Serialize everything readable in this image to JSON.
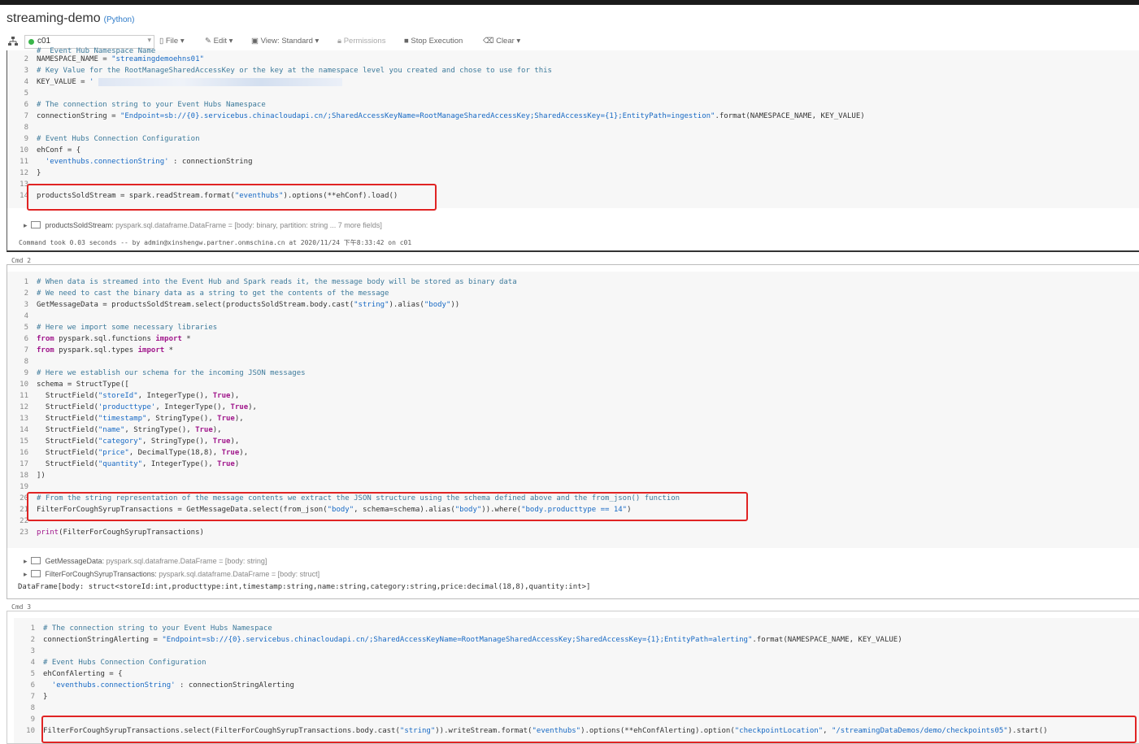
{
  "notebook": {
    "title": "streaming-demo",
    "language": "(Python)"
  },
  "toolbar": {
    "cluster": "c01",
    "file": "File",
    "edit": "Edit",
    "view": "View: Standard",
    "permissions": "Permissions",
    "stop": "Stop Execution",
    "clear": "Clear"
  },
  "cmd1": {
    "lines": [
      "NAMESPACE_NAME = \"streamingdemoehns01\"",
      "# Key Value for the RootManageSharedAccessKey or the key at the namespace level you created and chose to use for this",
      "KEY_VALUE = '",
      "",
      "# The connection string to your Event Hubs Namespace",
      "connectionString = \"Endpoint=sb://{0}.servicebus.chinacloudapi.cn/;SharedAccessKeyName=RootManageSharedAccessKey;SharedAccessKey={1};EntityPath=ingestion\".format(NAMESPACE_NAME, KEY_VALUE)",
      "",
      "# Event Hubs Connection Configuration",
      "ehConf = {",
      "  'eventhubs.connectionString' : connectionString",
      "}",
      "",
      "productsSoldStream = spark.readStream.format(\"eventhubs\").options(**ehConf).load()"
    ],
    "output": {
      "var": "productsSoldStream:",
      "type": "pyspark.sql.dataframe.DataFrame = [body: binary, partition: string ... 7 more fields]"
    },
    "footer": "Command took 0.03 seconds -- by admin@xinshengw.partner.onmschina.cn at 2020/11/24 下午8:33:42 on c01"
  },
  "cmd2": {
    "label": "Cmd 2",
    "lines": [
      "# When data is streamed into the Event Hub and Spark reads it, the message body will be stored as binary data",
      "# We need to cast the binary data as a string to get the contents of the message",
      "GetMessageData = productsSoldStream.select(productsSoldStream.body.cast(\"string\").alias(\"body\"))",
      "",
      "# Here we import some necessary libraries",
      "from pyspark.sql.functions import *",
      "from pyspark.sql.types import *",
      "",
      "# Here we establish our schema for the incoming JSON messages",
      "schema = StructType([",
      "  StructField(\"storeId\", IntegerType(), True),",
      "  StructField('producttype', IntegerType(), True),",
      "  StructField(\"timestamp\", StringType(), True),",
      "  StructField(\"name\", StringType(), True),",
      "  StructField(\"category\", StringType(), True),",
      "  StructField(\"price\", DecimalType(18,8), True),",
      "  StructField(\"quantity\", IntegerType(), True)",
      "])",
      "",
      "# From the string representation of the message contents we extract the JSON structure using the schema defined above and the from_json() function",
      "FilterForCoughSyrupTransactions = GetMessageData.select(from_json(\"body\", schema=schema).alias(\"body\")).where(\"body.producttype == 14\")",
      "",
      "print(FilterForCoughSyrupTransactions)"
    ],
    "outputs": [
      {
        "var": "GetMessageData:",
        "type": "pyspark.sql.dataframe.DataFrame = [body: string]"
      },
      {
        "var": "FilterForCoughSyrupTransactions:",
        "type": "pyspark.sql.dataframe.DataFrame = [body: struct]"
      }
    ],
    "printed": "DataFrame[body: struct<storeId:int,producttype:int,timestamp:string,name:string,category:string,price:decimal(18,8),quantity:int>]"
  },
  "cmd3": {
    "label": "Cmd 3",
    "lines": [
      "# The connection string to your Event Hubs Namespace",
      "connectionStringAlerting = \"Endpoint=sb://{0}.servicebus.chinacloudapi.cn/;SharedAccessKeyName=RootManageSharedAccessKey;SharedAccessKey={1};EntityPath=alerting\".format(NAMESPACE_NAME, KEY_VALUE)",
      "",
      "# Event Hubs Connection Configuration",
      "ehConfAlerting = {",
      "  'eventhubs.connectionString' : connectionStringAlerting",
      "}",
      "",
      "",
      "FilterForCoughSyrupTransactions.select(FilterForCoughSyrupTransactions.body.cast(\"string\")).writeStream.format(\"eventhubs\").options(**ehConfAlerting).option(\"checkpointLocation\", \"/streamingDataDemos/demo/checkpoints05\").start()"
    ]
  }
}
